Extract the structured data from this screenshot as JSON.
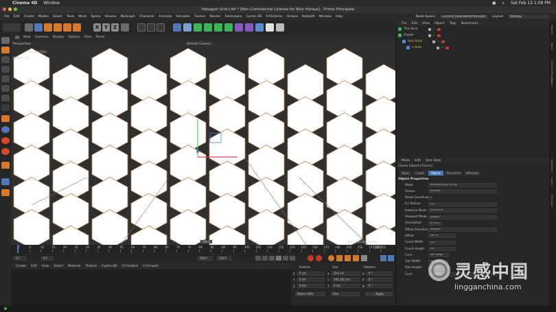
{
  "macos": {
    "apple": "",
    "app_name": "Cinema 4D",
    "window_menu": "Window",
    "clock": "Sat Feb 13  1:08 PM"
  },
  "window_title": "Hexagon Grid.c4d * (Non-Commercial License for Nick Harauz) - Prime Principale",
  "menu": [
    "File",
    "Edit",
    "Create",
    "Modes",
    "Select",
    "Tools",
    "Mesh",
    "Spline",
    "Volume",
    "MoGraph",
    "Character",
    "Animate",
    "Simulate",
    "Tracker",
    "Render",
    "Extensions",
    "Cycles 4D",
    "X-Particles",
    "Octane",
    "Redshift",
    "Window",
    "Help"
  ],
  "node_space": {
    "label": "Node Space:",
    "value": "Current (Standard/Physical)"
  },
  "layout": {
    "label": "Layout:",
    "value": "Startup"
  },
  "toolbar_axes": [
    "X",
    "Y",
    "Z"
  ],
  "viewport": {
    "menus": [
      "View",
      "Cameras",
      "Display",
      "Options",
      "Filter",
      "Panel"
    ],
    "perspective_label": "Perspective",
    "camera_label": "Default Camera",
    "selected_label": "Selected  Total",
    "objects_label": "Objects  1        6",
    "grid_spacing": "Grid Spacing : 50 cm",
    "readout": "181.8"
  },
  "timeline": {
    "ticks": [
      "0",
      "5",
      "10",
      "15",
      "20",
      "25",
      "30",
      "35",
      "40",
      "45",
      "50",
      "55",
      "60",
      "65",
      "70",
      "75",
      "80",
      "85",
      "90",
      "95",
      "100",
      "105",
      "110",
      "115",
      "120",
      "125",
      "130",
      "135",
      "140",
      "145",
      "150",
      "155",
      "160"
    ],
    "frame_end": "160 F"
  },
  "transport": {
    "current": "0 F",
    "start": "0 F",
    "end": "150 F",
    "end2": "150 F"
  },
  "material_menu": [
    "Create",
    "Edit",
    "View",
    "Select",
    "Material",
    "Texture",
    "Cycles 4D",
    "CV-Swatch",
    "CV-Import"
  ],
  "coords": {
    "headers": [
      "Position",
      "Size",
      "Rotation"
    ],
    "rows": [
      {
        "axis": "X",
        "pos": "0 cm",
        "size_axis": "X",
        "size": "316 cm",
        "rot_axis": "H",
        "rot": "0 °"
      },
      {
        "axis": "Y",
        "pos": "0 cm",
        "size_axis": "Y",
        "size": "192.181 cm",
        "rot_axis": "P",
        "rot": "0 °"
      },
      {
        "axis": "Z",
        "pos": "0 cm",
        "size_axis": "Z",
        "size": "0 cm",
        "rot_axis": "B",
        "rot": "0 °"
      }
    ],
    "mode1": "Object (Rel)",
    "mode2": "Size",
    "apply": "Apply"
  },
  "object_manager": {
    "menus": [
      "File",
      "Edit",
      "View",
      "Object",
      "Tags",
      "Bookmarks"
    ],
    "objects": [
      {
        "name": "The Hero",
        "color": "#b8c8d8"
      },
      {
        "name": "Cloner",
        "color": "#c8d8e8"
      },
      {
        "name": "Hex Base",
        "color": "#e4b04a"
      },
      {
        "name": "n-Side",
        "color": "#e4b04a"
      }
    ]
  },
  "attribute_manager": {
    "menus": [
      "Mode",
      "Edit",
      "User Data"
    ],
    "object_title": "Cloner Object [Cloner]",
    "tabs": [
      "Basic",
      "Coord.",
      "Object",
      "Transform",
      "Effectors"
    ],
    "active_tab": "Object",
    "section": "Object Properties",
    "rows": [
      {
        "label": "Mode",
        "value": "Honeycomb Array"
      },
      {
        "label": "Clones",
        "value": "Iterate"
      },
      {
        "label": "Reset Coordinates",
        "value": "✓"
      },
      {
        "label": "Fix Texture",
        "value": "Off"
      },
      {
        "label": "Instance Mode",
        "value": "Instance"
      },
      {
        "label": "Viewport Mode",
        "value": "Object"
      },
      {
        "label": "Orientation",
        "value": "Z (XY)"
      },
      {
        "label": "Offset Direction",
        "value": "Height"
      },
      {
        "label": "Offset",
        "value": "50 %"
      },
      {
        "label": "Count Width",
        "value": "10"
      },
      {
        "label": "Count Height",
        "value": "10"
      },
      {
        "label": "Form",
        "value": "No Shap"
      },
      {
        "label": "Size Width",
        "value": "30 cm"
      },
      {
        "label": "Size Height",
        "value": "30 cm"
      },
      {
        "label": "Form",
        "value": "Square"
      }
    ]
  },
  "right_strip": [
    "Objects",
    "Takes",
    "Content Browser",
    "Layers"
  ],
  "right_strip2": [
    "Attributes",
    "Layers",
    "Structure"
  ],
  "watermark": {
    "cn": "灵感中国",
    "url": "lingganchina.com"
  },
  "colors": {
    "accent": "#4a78b8",
    "hex_fill": "#ffffff",
    "hex_edge": "#b58a5a",
    "viewport_bg": "#2f2f2f"
  }
}
